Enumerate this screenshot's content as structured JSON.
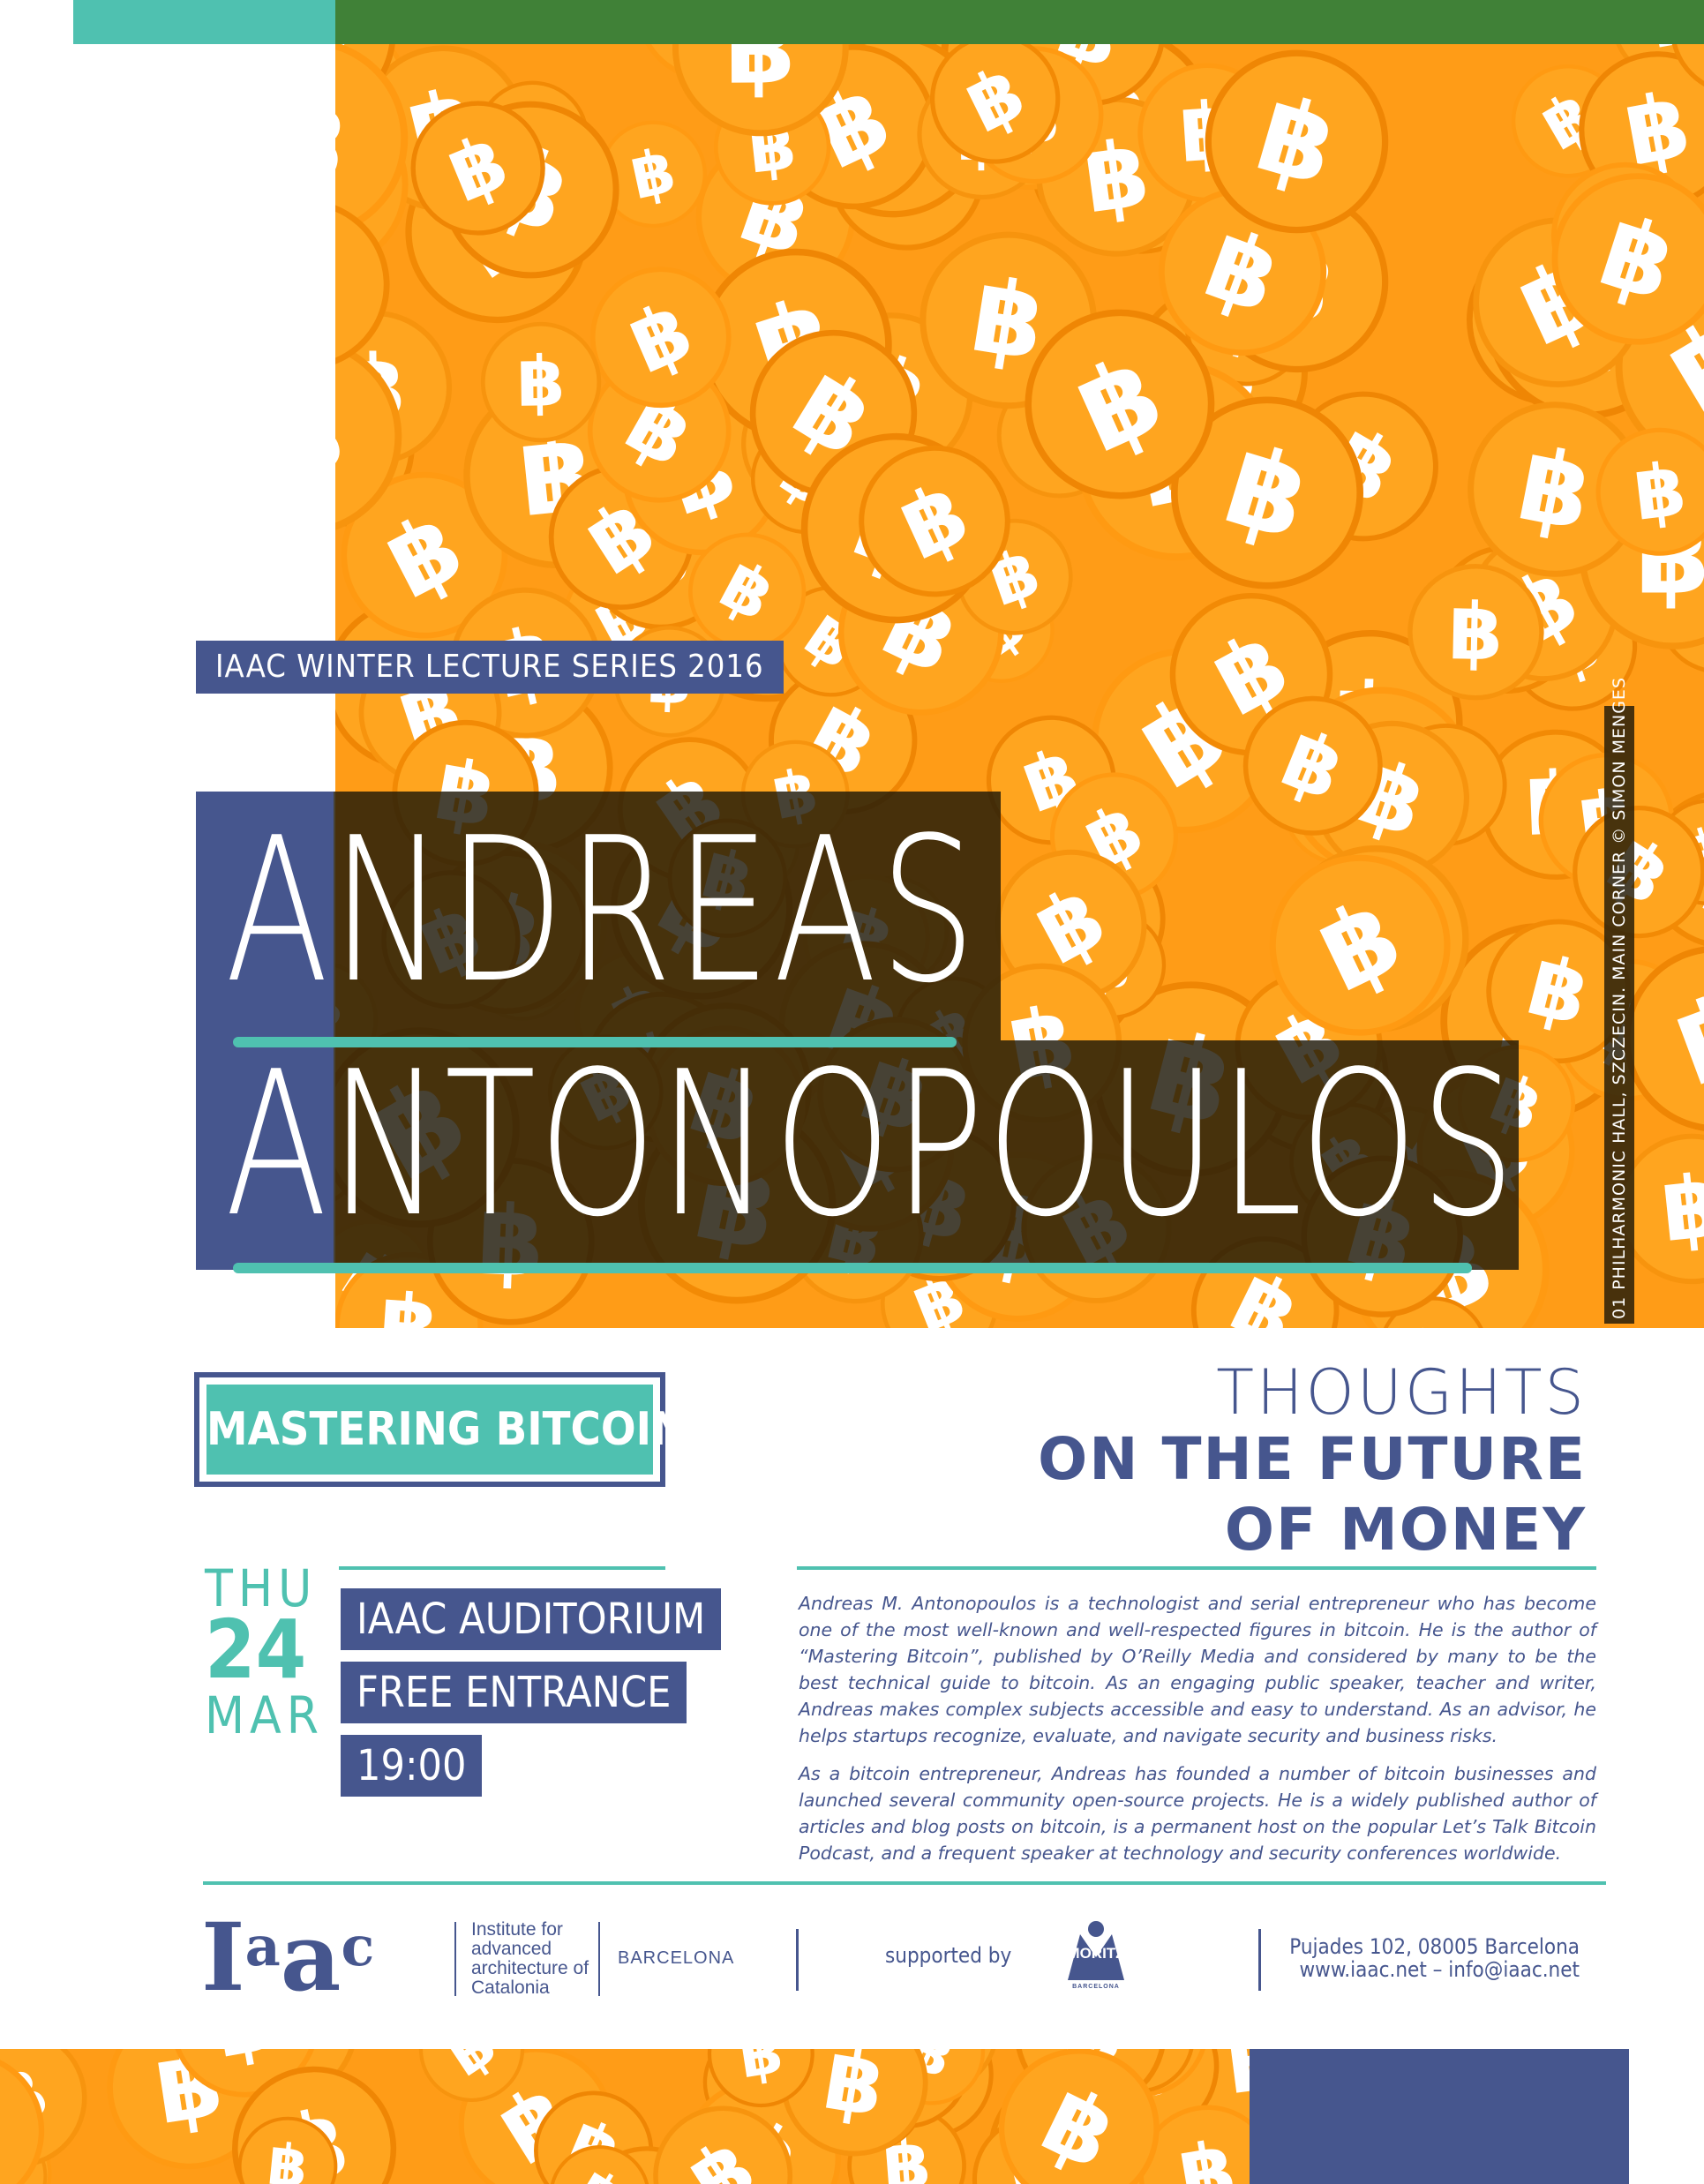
{
  "series_label": "IAAC WINTER LECTURE SERIES 2016",
  "speaker": {
    "first_name": "ANDREAS",
    "last_name": "ANTONOPOULOS"
  },
  "photo_credit": "01 PHILHARMONIC HALL, SZCZECIN. MAIN CORNER  © SIMON MENGES",
  "lecture_title": "MASTERING BITCOIN",
  "subtitle": {
    "line1": "THOUGHTS",
    "line2": "ON THE FUTURE",
    "line3": "OF MONEY"
  },
  "date": {
    "day": "THU",
    "number": "24",
    "month": "MAR"
  },
  "event": {
    "venue": "IAAC AUDITORIUM",
    "entrance": "FREE ENTRANCE",
    "time": "19:00"
  },
  "bio": [
    "Andreas M. Antonopoulos is a technologist and serial entrepreneur who has become one of the most well-known and well-respected figures in bitcoin. He is the author of “Mastering Bitcoin”, published by O’Reilly Media and considered by many to be the best technical guide to bitcoin. As an engaging public speaker, teacher and writer,  Andreas makes complex subjects accessible and easy to understand. As an advisor, he helps startups recognize, evaluate, and navigate security and business risks.",
    "As a bitcoin entrepreneur, Andreas has founded a number of bitcoin businesses and launched several community open-source projects. He is a widely published author of articles and blog posts on bitcoin, is a permanent host on the popular Let’s Talk Bitcoin Podcast, and a frequent speaker at technology and security conferences worldwide."
  ],
  "footer": {
    "logo": {
      "part1": "I",
      "part2": "a",
      "part3": "a",
      "part4": "c"
    },
    "institute_name": "Institute for advanced architecture of Catalonia",
    "city": "BARCELONA",
    "supported_by": "supported by",
    "sponsor": {
      "name": "MORITZ",
      "sub": "BARCELONA"
    },
    "address": "Pujades 102, 08005 Barcelona",
    "web_email": "www.iaac.net – info@iaac.net"
  },
  "colors": {
    "navy": "#46568e",
    "teal": "#4fc1b0",
    "orange": "#ff9c17",
    "white": "#ffffff"
  },
  "icons": [
    "bitcoin-coin-icon"
  ]
}
